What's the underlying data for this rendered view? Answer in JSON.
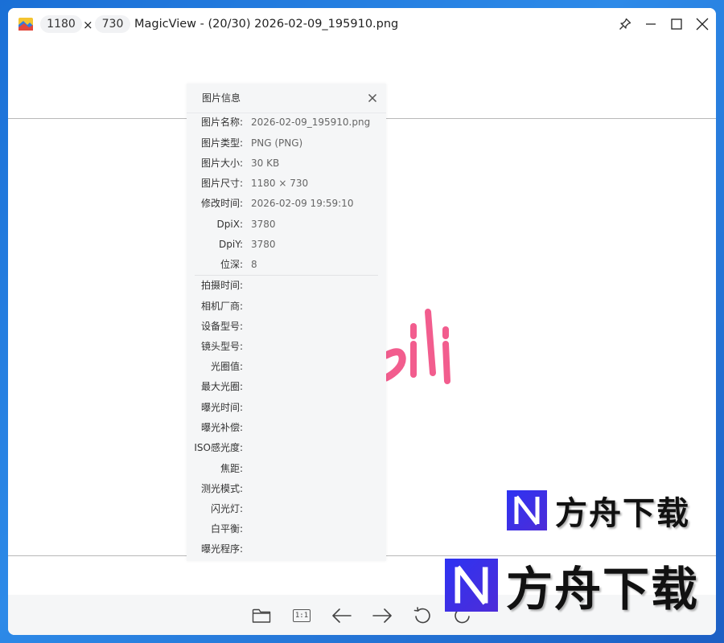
{
  "titlebar": {
    "width": "1180",
    "times": "×",
    "height": "730",
    "title": "MagicView - (20/30) 2026-02-09_195910.png"
  },
  "info_panel": {
    "title": "图片信息",
    "basic": [
      {
        "label": "图片名称:",
        "value": "2026-02-09_195910.png"
      },
      {
        "label": "图片类型:",
        "value": "PNG (PNG)"
      },
      {
        "label": "图片大小:",
        "value": "30 KB"
      },
      {
        "label": "图片尺寸:",
        "value": "1180 × 730"
      },
      {
        "label": "修改时间:",
        "value": "2026-02-09 19:59:10"
      },
      {
        "label": "DpiX:",
        "value": "3780"
      },
      {
        "label": "DpiY:",
        "value": "3780"
      },
      {
        "label": "位深:",
        "value": "8"
      }
    ],
    "exif": [
      {
        "label": "拍摄时间:",
        "value": ""
      },
      {
        "label": "相机厂商:",
        "value": ""
      },
      {
        "label": "设备型号:",
        "value": ""
      },
      {
        "label": "镜头型号:",
        "value": ""
      },
      {
        "label": "光圈值:",
        "value": ""
      },
      {
        "label": "最大光圈:",
        "value": ""
      },
      {
        "label": "曝光时间:",
        "value": ""
      },
      {
        "label": "曝光补偿:",
        "value": ""
      },
      {
        "label": "ISO感光度:",
        "value": ""
      },
      {
        "label": "焦距:",
        "value": ""
      },
      {
        "label": "测光模式:",
        "value": ""
      },
      {
        "label": "闪光灯:",
        "value": ""
      },
      {
        "label": "白平衡:",
        "value": ""
      },
      {
        "label": "曝光程序:",
        "value": ""
      }
    ]
  },
  "toolbar": {
    "one_to_one": "1:1"
  },
  "watermark": {
    "text": "方舟下载"
  },
  "colors": {
    "panel_bg": "#f5f6f7",
    "bili_pink": "#f25d8e",
    "watermark_blue": "#2b3df0"
  },
  "icons": [
    "pin-icon",
    "minimize-icon",
    "maximize-icon",
    "close-icon",
    "folder-icon",
    "one-to-one-icon",
    "arrow-left-icon",
    "arrow-right-icon",
    "rotate-left-icon",
    "rotate-right-icon"
  ]
}
